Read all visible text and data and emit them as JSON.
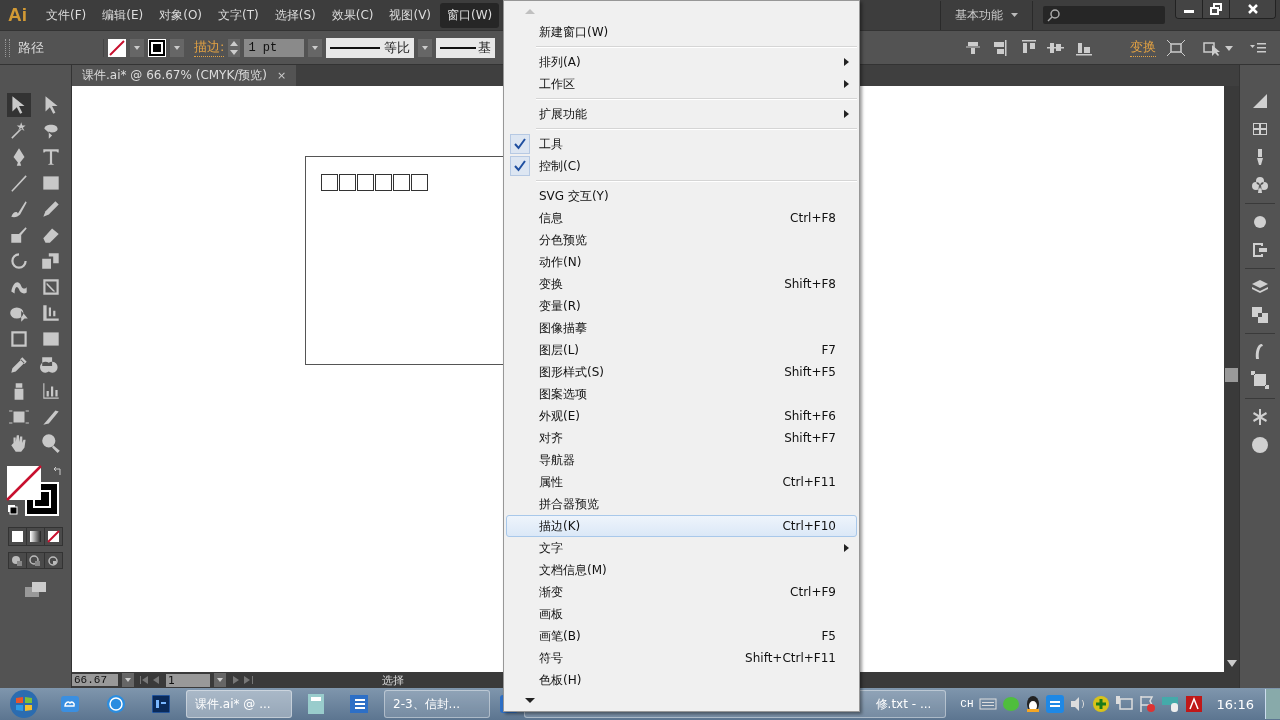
{
  "app": {
    "logo": "Ai"
  },
  "menu_bar": [
    {
      "label": "文件(F)",
      "selected": false
    },
    {
      "label": "编辑(E)",
      "selected": false
    },
    {
      "label": "对象(O)",
      "selected": false
    },
    {
      "label": "文字(T)",
      "selected": false
    },
    {
      "label": "选择(S)",
      "selected": false
    },
    {
      "label": "效果(C)",
      "selected": false
    },
    {
      "label": "视图(V)",
      "selected": false
    },
    {
      "label": "窗口(W)",
      "selected": true
    }
  ],
  "workspace": {
    "label": "基本功能"
  },
  "control_bar": {
    "selection_label": "路径",
    "stroke_label": "描边:",
    "stroke_weight": "1 pt",
    "profile_label": "等比",
    "brush_label": "基",
    "transform_label": "变换"
  },
  "document_tab": {
    "title": "课件.ai* @ 66.67% (CMYK/预览)",
    "close": "×"
  },
  "status_bar": {
    "zoom": "66.67",
    "page": "1",
    "tool": "选择"
  },
  "window_menu": {
    "groups": [
      [
        {
          "label": "新建窗口(W)",
          "submenu": false,
          "checked": false,
          "selected": false
        }
      ],
      [
        {
          "label": "排列(A)",
          "submenu": true,
          "checked": false,
          "selected": false
        },
        {
          "label": "工作区",
          "submenu": true,
          "checked": false,
          "selected": false
        }
      ],
      [
        {
          "label": "扩展功能",
          "submenu": true,
          "checked": false,
          "selected": false
        }
      ],
      [
        {
          "label": "工具",
          "submenu": false,
          "checked": true,
          "selected": false
        },
        {
          "label": "控制(C)",
          "submenu": false,
          "checked": true,
          "selected": false
        }
      ],
      [
        {
          "label": "SVG 交互(Y)",
          "submenu": false,
          "checked": false,
          "selected": false
        },
        {
          "label": "信息",
          "shortcut": "Ctrl+F8",
          "submenu": false,
          "checked": false,
          "selected": false
        },
        {
          "label": "分色预览",
          "submenu": false,
          "checked": false,
          "selected": false
        },
        {
          "label": "动作(N)",
          "submenu": false,
          "checked": false,
          "selected": false
        },
        {
          "label": "变换",
          "shortcut": "Shift+F8",
          "submenu": false,
          "checked": false,
          "selected": false
        },
        {
          "label": "变量(R)",
          "submenu": false,
          "checked": false,
          "selected": false
        },
        {
          "label": "图像描摹",
          "submenu": false,
          "checked": false,
          "selected": false
        },
        {
          "label": "图层(L)",
          "shortcut": "F7",
          "submenu": false,
          "checked": false,
          "selected": false
        },
        {
          "label": "图形样式(S)",
          "shortcut": "Shift+F5",
          "submenu": false,
          "checked": false,
          "selected": false
        },
        {
          "label": "图案选项",
          "submenu": false,
          "checked": false,
          "selected": false
        },
        {
          "label": "外观(E)",
          "shortcut": "Shift+F6",
          "submenu": false,
          "checked": false,
          "selected": false
        },
        {
          "label": "对齐",
          "shortcut": "Shift+F7",
          "submenu": false,
          "checked": false,
          "selected": false
        },
        {
          "label": "导航器",
          "submenu": false,
          "checked": false,
          "selected": false
        },
        {
          "label": "属性",
          "shortcut": "Ctrl+F11",
          "submenu": false,
          "checked": false,
          "selected": false
        },
        {
          "label": "拼合器预览",
          "submenu": false,
          "checked": false,
          "selected": false
        },
        {
          "label": "描边(K)",
          "shortcut": "Ctrl+F10",
          "submenu": false,
          "checked": false,
          "selected": true
        },
        {
          "label": "文字",
          "submenu": true,
          "checked": false,
          "selected": false
        },
        {
          "label": "文档信息(M)",
          "submenu": false,
          "checked": false,
          "selected": false
        },
        {
          "label": "渐变",
          "shortcut": "Ctrl+F9",
          "submenu": false,
          "checked": false,
          "selected": false
        },
        {
          "label": "画板",
          "submenu": false,
          "checked": false,
          "selected": false
        },
        {
          "label": "画笔(B)",
          "shortcut": "F5",
          "submenu": false,
          "checked": false,
          "selected": false
        },
        {
          "label": "符号",
          "shortcut": "Shift+Ctrl+F11",
          "submenu": false,
          "checked": false,
          "selected": false
        },
        {
          "label": "色板(H)",
          "submenu": false,
          "checked": false,
          "selected": false
        }
      ]
    ]
  },
  "taskbar": {
    "tasks": [
      {
        "label": "课件.ai* @ ...",
        "selected": true
      },
      {
        "label": "2-3、信封...",
        "selected": false
      },
      {
        "label": "修.txt - ...",
        "selected": false
      }
    ],
    "language": "CH",
    "clock": "16:16"
  }
}
